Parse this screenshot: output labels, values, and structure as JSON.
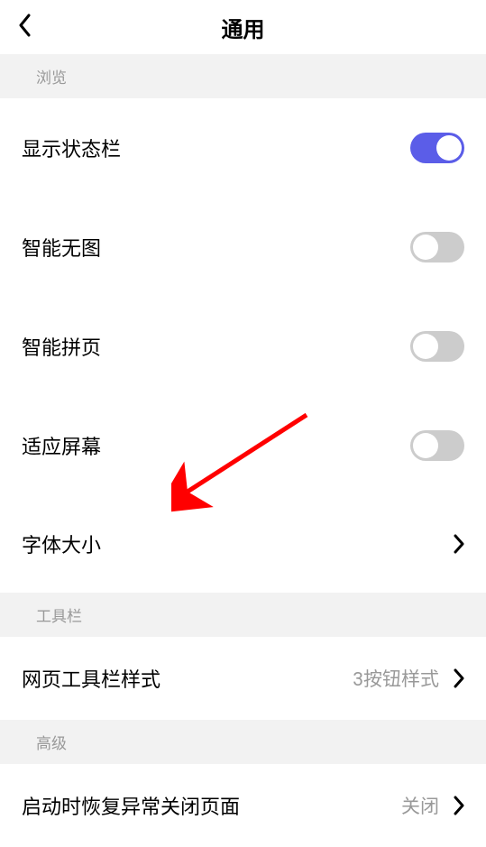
{
  "header": {
    "title": "通用"
  },
  "sections": {
    "browse": {
      "title": "浏览",
      "items": {
        "statusBar": {
          "label": "显示状态栏",
          "toggle": true
        },
        "smartNoImage": {
          "label": "智能无图",
          "toggle": false
        },
        "smartPaging": {
          "label": "智能拼页",
          "toggle": false
        },
        "fitScreen": {
          "label": "适应屏幕",
          "toggle": false
        },
        "fontSize": {
          "label": "字体大小"
        }
      }
    },
    "toolbar": {
      "title": "工具栏",
      "items": {
        "webToolbarStyle": {
          "label": "网页工具栏样式",
          "value": "3按钮样式"
        }
      }
    },
    "advanced": {
      "title": "高级",
      "items": {
        "restoreOnCrash": {
          "label": "启动时恢复异常关闭页面",
          "value": "关闭"
        }
      }
    }
  }
}
